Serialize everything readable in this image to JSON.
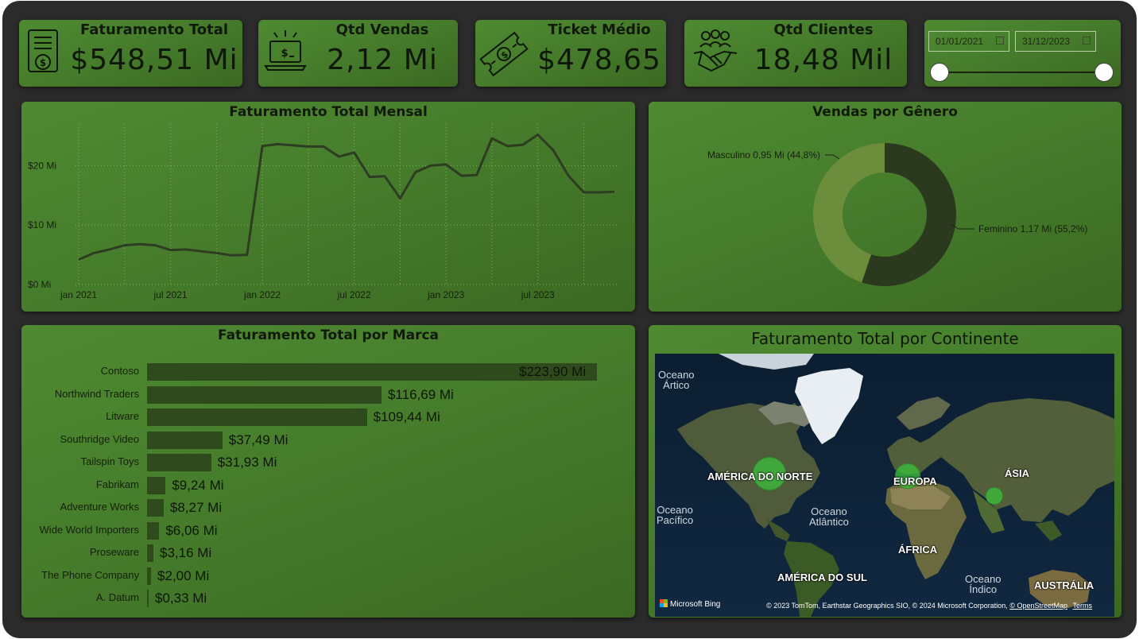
{
  "kpis": {
    "revenue": {
      "title": "Faturamento Total",
      "value": "$548,51 Mi",
      "icon": "invoice-icon"
    },
    "sales": {
      "title": "Qtd Vendas",
      "value": "2,12 Mi",
      "icon": "laptop-sales-icon"
    },
    "ticket": {
      "title": "Ticket Médio",
      "value": "$478,65",
      "icon": "ticket-dollar-icon"
    },
    "customers": {
      "title": "Qtd Clientes",
      "value": "18,48 Mil",
      "icon": "handshake-icon"
    }
  },
  "date_slicer": {
    "start": "01/01/2021",
    "end": "31/12/2023"
  },
  "monthly": {
    "title": "Faturamento Total Mensal",
    "y_ticks": [
      "$20 Mi",
      "$10 Mi",
      "$0 Mi"
    ],
    "x_ticks": [
      "jan 2021",
      "jul 2021",
      "jan 2022",
      "jul 2022",
      "jan 2023",
      "jul 2023"
    ]
  },
  "gender": {
    "title": "Vendas por Gênero",
    "male_label": "Masculino 0,95 Mi (44,8%)",
    "female_label": "Feminino 1,17 Mi (55,2%)"
  },
  "brands": {
    "title": "Faturamento Total por Marca",
    "rows": [
      {
        "name": "Contoso",
        "label": "$223,90 Mi"
      },
      {
        "name": "Northwind Traders",
        "label": "$116,69 Mi"
      },
      {
        "name": "Litware",
        "label": "$109,44 Mi"
      },
      {
        "name": "Southridge Video",
        "label": "$37,49 Mi"
      },
      {
        "name": "Tailspin Toys",
        "label": "$31,93 Mi"
      },
      {
        "name": "Fabrikam",
        "label": "$9,24 Mi"
      },
      {
        "name": "Adventure Works",
        "label": "$8,27 Mi"
      },
      {
        "name": "Wide World Importers",
        "label": "$6,06 Mi"
      },
      {
        "name": "Proseware",
        "label": "$3,16 Mi"
      },
      {
        "name": "The Phone Company",
        "label": "$2,00 Mi"
      },
      {
        "name": "A. Datum",
        "label": "$0,33 Mi"
      }
    ]
  },
  "map": {
    "title": "Faturamento Total por Continente",
    "labels": {
      "north_america": "AMÉRICA DO NORTE",
      "europe": "EUROPA",
      "asia": "ÁSIA",
      "africa": "ÁFRICA",
      "south_america": "AMÉRICA DO SUL",
      "australia": "AUSTRÁLIA"
    },
    "oceans": {
      "arctic": "Oceano\nÁrtico",
      "pacific": "Oceano\nPacífico",
      "atlantic": "Oceano\nAtlântico",
      "indian": "Oceano\nÍndico"
    },
    "bing": "Microsoft Bing",
    "attribution": "© 2023 TomTom, Earthstar Geographics SIO, © 2024 Microsoft Corporation,",
    "osm_link": "© OpenStreetMap",
    "terms_link": "Terms"
  },
  "chart_data": [
    {
      "type": "line",
      "title": "Faturamento Total Mensal",
      "x": [
        "2021-01",
        "2021-02",
        "2021-03",
        "2021-04",
        "2021-05",
        "2021-06",
        "2021-07",
        "2021-08",
        "2021-09",
        "2021-10",
        "2021-11",
        "2021-12",
        "2022-01",
        "2022-02",
        "2022-03",
        "2022-04",
        "2022-05",
        "2022-06",
        "2022-07",
        "2022-08",
        "2022-09",
        "2022-10",
        "2022-11",
        "2022-12",
        "2023-01",
        "2023-02",
        "2023-03",
        "2023-04",
        "2023-05",
        "2023-06",
        "2023-07",
        "2023-08",
        "2023-09",
        "2023-10",
        "2023-11",
        "2023-12"
      ],
      "series": [
        {
          "values": [
            4.2,
            5.3,
            5.9,
            6.6,
            6.8,
            6.6,
            5.8,
            5.9,
            5.6,
            5.3,
            4.9,
            5.0,
            23.3,
            23.6,
            23.4,
            23.2,
            23.2,
            21.5,
            22.2,
            18.1,
            18.2,
            14.5,
            18.9,
            20.0,
            20.2,
            18.3,
            18.4,
            24.6,
            23.3,
            23.5,
            25.2,
            22.6,
            18.3,
            15.5,
            15.5,
            15.6
          ]
        }
      ],
      "y_ticks": [
        "$20 Mi",
        "$10 Mi",
        "$0 Mi"
      ],
      "ylim": [
        0,
        27
      ],
      "grid": true
    },
    {
      "type": "pie",
      "title": "Vendas por Gênero",
      "categories": [
        "Masculino",
        "Feminino"
      ],
      "values": [
        0.95,
        1.17
      ],
      "percent": [
        44.8,
        55.2
      ],
      "colors": [
        "#6c8d3c",
        "#2b3a1e"
      ],
      "donut": true
    },
    {
      "type": "bar",
      "orientation": "horizontal",
      "title": "Faturamento Total por Marca",
      "categories": [
        "Contoso",
        "Northwind Traders",
        "Litware",
        "Southridge Video",
        "Tailspin Toys",
        "Fabrikam",
        "Adventure Works",
        "Wide World Importers",
        "Proseware",
        "The Phone Company",
        "A. Datum"
      ],
      "values": [
        223.9,
        116.69,
        109.44,
        37.49,
        31.93,
        9.24,
        8.27,
        6.06,
        3.16,
        2.0,
        0.33
      ],
      "unit": "Mi",
      "color": "#2f4a1d"
    },
    {
      "type": "scatter",
      "title": "Faturamento Total por Continente",
      "categories": [
        "AMÉRICA DO NORTE",
        "EUROPA",
        "ÁSIA"
      ],
      "bubble_colors": [
        "#3fbf3f"
      ]
    }
  ]
}
